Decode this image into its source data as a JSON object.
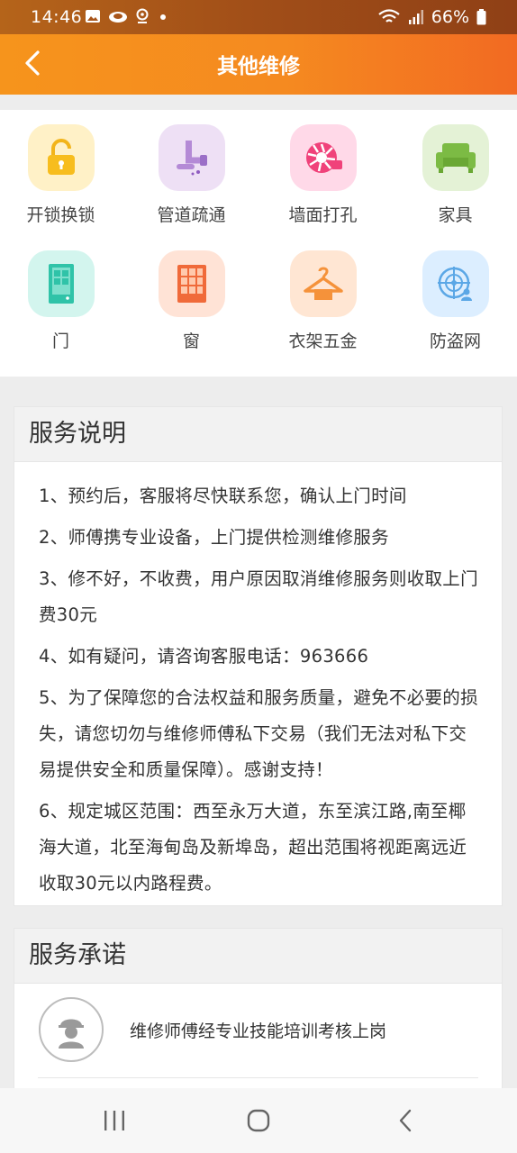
{
  "status_bar": {
    "time": "14:46",
    "battery": "66%",
    "icons_left": [
      "image-icon",
      "cloud-icon",
      "location-icon",
      "dot-icon"
    ],
    "icons_right": [
      "wifi-icon",
      "signal-icon",
      "battery-icon"
    ]
  },
  "header": {
    "title": "其他维修",
    "back_icon": "chevron-left-icon",
    "gradient_start": "#f6941c",
    "gradient_end": "#f26a22"
  },
  "categories": [
    {
      "label": "开锁换锁",
      "icon": "lock-icon",
      "tile_color": "#fff1c7"
    },
    {
      "label": "管道疏通",
      "icon": "pipe-icon",
      "tile_color": "#eee0f5"
    },
    {
      "label": "墙面打孔",
      "icon": "drill-icon",
      "tile_color": "#ffd9e8"
    },
    {
      "label": "家具",
      "icon": "sofa-icon",
      "tile_color": "#e4f2d6"
    },
    {
      "label": "门",
      "icon": "door-icon",
      "tile_color": "#d3f5ee"
    },
    {
      "label": "窗",
      "icon": "window-icon",
      "tile_color": "#ffe3d6"
    },
    {
      "label": "衣架五金",
      "icon": "hanger-icon",
      "tile_color": "#ffe6d3"
    },
    {
      "label": "防盗网",
      "icon": "security-net-icon",
      "tile_color": "#dceeff"
    }
  ],
  "service_description": {
    "title": "服务说明",
    "items": [
      "1、预约后，客服将尽快联系您，确认上门时间",
      "2、师傅携专业设备，上门提供检测维修服务",
      "3、修不好，不收费，用户原因取消维修服务则收取上门费30元",
      "4、如有疑问，请咨询客服电话：963666",
      "5、为了保障您的合法权益和服务质量，避免不必要的损失，请您切勿与维修师傅私下交易（我们无法对私下交易提供安全和质量保障）。感谢支持！",
      "6、规定城区范围：西至永万大道，东至滨江路,南至椰海大道，北至海甸岛及新埠岛，超出范围将视距离远近收取30元以内路程费。"
    ]
  },
  "service_promise": {
    "title": "服务承诺",
    "items": [
      {
        "icon": "worker-icon",
        "text": "维修师傅经专业技能培训考核上岗"
      }
    ]
  },
  "nav_bar": {
    "buttons": [
      "recent-apps-icon",
      "home-icon",
      "back-icon"
    ]
  }
}
